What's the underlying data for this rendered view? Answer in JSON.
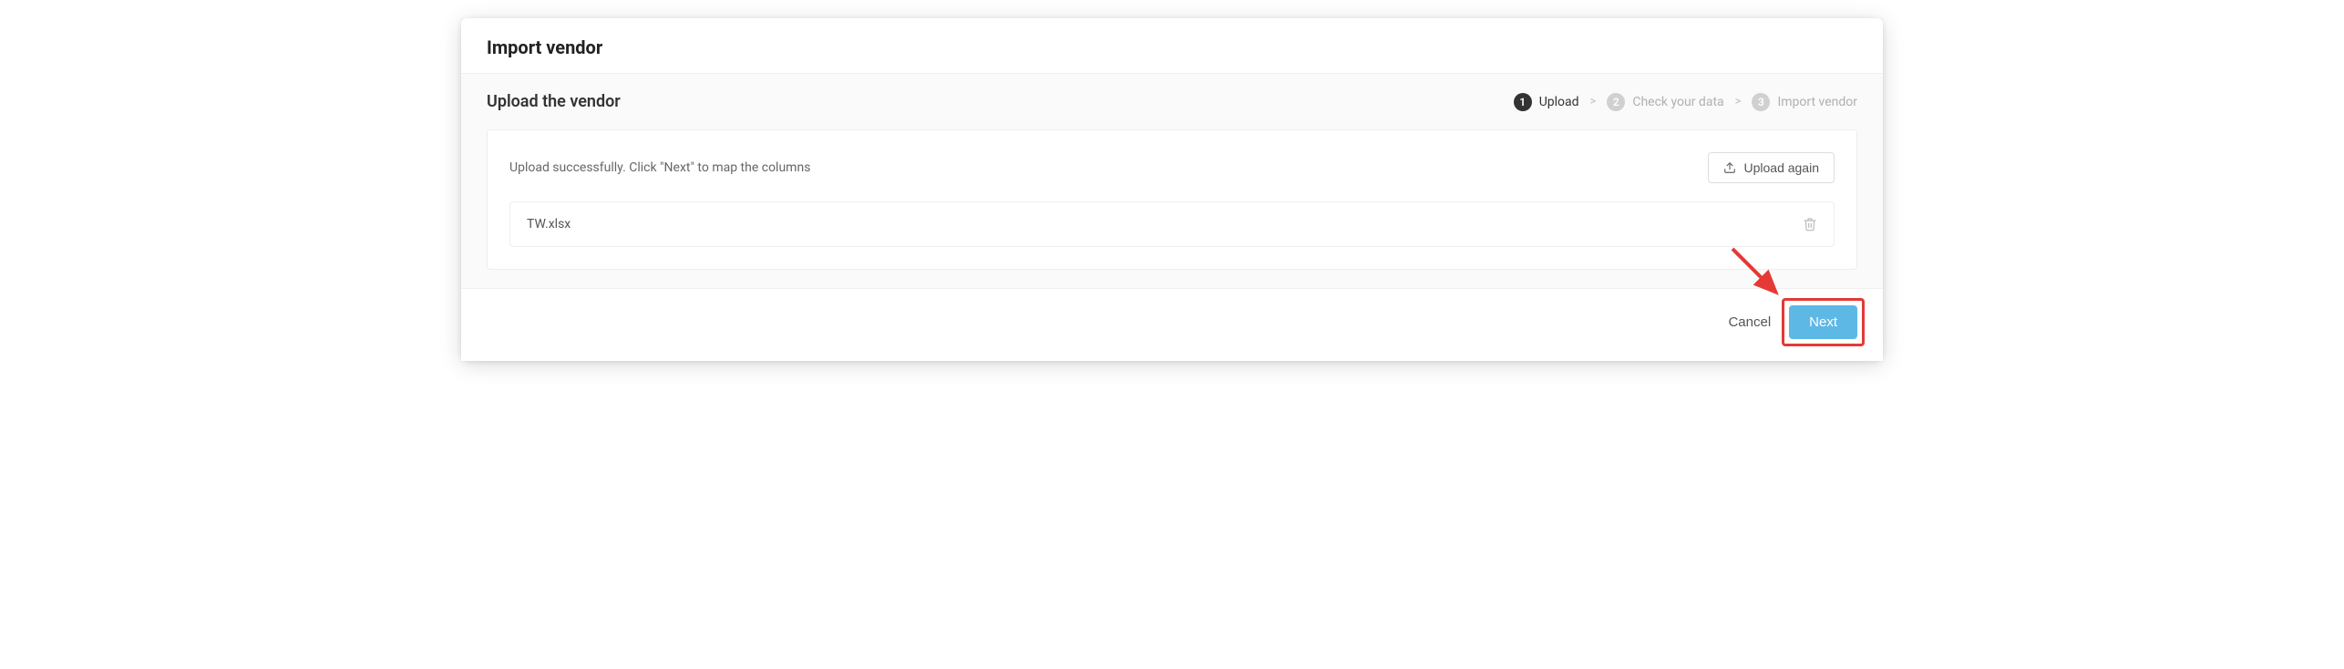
{
  "modal": {
    "title": "Import vendor"
  },
  "section": {
    "title": "Upload the vendor"
  },
  "stepper": {
    "steps": [
      {
        "num": "1",
        "label": "Upload"
      },
      {
        "num": "2",
        "label": "Check your data"
      },
      {
        "num": "3",
        "label": "Import vendor"
      }
    ],
    "sep": ">"
  },
  "upload": {
    "message": "Upload successfully. Click \"Next\" to map the columns",
    "again_label": "Upload again",
    "file_name": "TW.xlsx"
  },
  "footer": {
    "cancel": "Cancel",
    "next": "Next"
  }
}
